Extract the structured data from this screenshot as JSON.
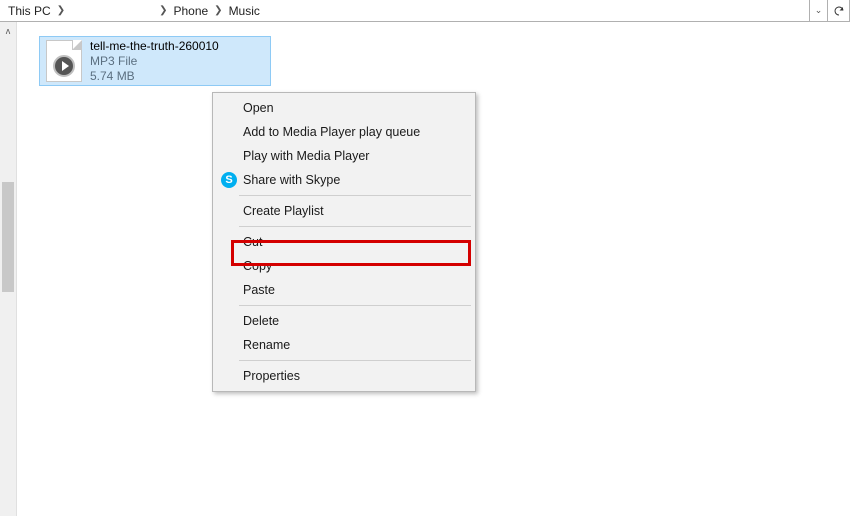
{
  "breadcrumb": {
    "root": "This PC",
    "seg_blank": "",
    "seg_phone": "Phone",
    "seg_music": "Music"
  },
  "file": {
    "name": "tell-me-the-truth-260010",
    "type": "MP3 File",
    "size": "5.74 MB"
  },
  "context_menu": {
    "open": "Open",
    "add_queue": "Add to Media Player play queue",
    "play_wmp": "Play with Media Player",
    "share_skype": "Share with Skype",
    "create_playlist": "Create Playlist",
    "cut": "Cut",
    "copy": "Copy",
    "paste": "Paste",
    "delete": "Delete",
    "rename": "Rename",
    "properties": "Properties"
  },
  "icons": {
    "skype_letter": "S"
  }
}
